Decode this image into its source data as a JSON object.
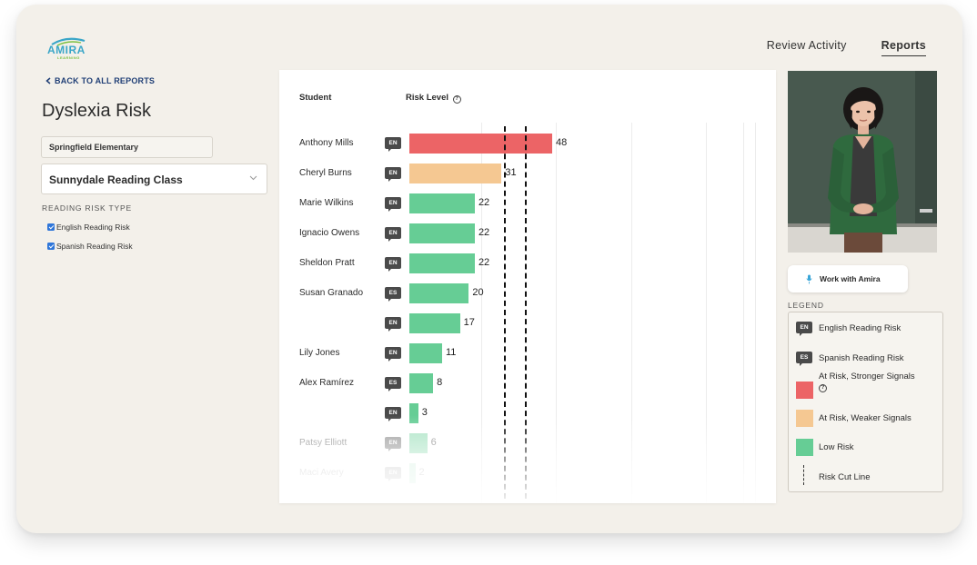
{
  "brand": {
    "logo_word": "AMIRA",
    "logo_sub": "LEARNING"
  },
  "nav": {
    "items": [
      {
        "label": "Review Activity"
      },
      {
        "label": "Reports"
      }
    ],
    "active": "Reports"
  },
  "sidebar": {
    "back_link": "BACK TO ALL REPORTS",
    "title": "Dyslexia Risk",
    "school": "Springfield Elementary",
    "class_select": "Sunnydale Reading Class",
    "risk_type_heading": "READING RISK TYPE",
    "risk_types": [
      {
        "label": "English Reading Risk",
        "checked": true
      },
      {
        "label": "Spanish Reading Risk",
        "checked": true
      }
    ]
  },
  "table": {
    "col_student": "Student",
    "col_risk": "Risk Level",
    "help_glyph": "?"
  },
  "colors": {
    "at_risk_stronger": "#ec6466",
    "at_risk_weaker": "#f5c892",
    "low_risk": "#66cd95",
    "badge": "#4a4a4a",
    "nav_link": "#1f3e75"
  },
  "chart_data": {
    "type": "bar",
    "orientation": "horizontal",
    "x_range": [
      0,
      80
    ],
    "cut_lines": [
      32,
      39
    ],
    "rows": [
      {
        "student": "Anthony Mills",
        "lang": "EN",
        "value": 48,
        "risk": "at_risk_stronger"
      },
      {
        "student": "Cheryl Burns",
        "lang": "EN",
        "value": 31,
        "risk": "at_risk_weaker"
      },
      {
        "student": "Marie Wilkins",
        "lang": "EN",
        "value": 22,
        "risk": "low_risk"
      },
      {
        "student": "Ignacio Owens",
        "lang": "EN",
        "value": 22,
        "risk": "low_risk"
      },
      {
        "student": "Sheldon Pratt",
        "lang": "EN",
        "value": 22,
        "risk": "low_risk"
      },
      {
        "student": "Susan Granado",
        "lang": "ES",
        "value": 20,
        "risk": "low_risk"
      },
      {
        "student": "",
        "lang": "EN",
        "value": 17,
        "risk": "low_risk"
      },
      {
        "student": "Lily Jones",
        "lang": "EN",
        "value": 11,
        "risk": "low_risk"
      },
      {
        "student": "Alex Ramírez",
        "lang": "ES",
        "value": 8,
        "risk": "low_risk"
      },
      {
        "student": "",
        "lang": "EN",
        "value": 3,
        "risk": "low_risk"
      },
      {
        "student": "Patsy Elliott",
        "lang": "EN",
        "value": 6,
        "risk": "low_risk"
      },
      {
        "student": "Maci Avery",
        "lang": "EN",
        "value": 2,
        "risk": "low_risk"
      }
    ]
  },
  "assistant": {
    "button_label": "Work with Amira"
  },
  "legend": {
    "title": "LEGEND",
    "items": [
      {
        "kind": "badge",
        "badge": "EN",
        "label": "English Reading Risk"
      },
      {
        "kind": "badge",
        "badge": "ES",
        "label": "Spanish Reading Risk"
      },
      {
        "kind": "swatch",
        "color": "#ec6466",
        "label": "At Risk, Stronger Signals",
        "help": "?"
      },
      {
        "kind": "swatch",
        "color": "#f5c892",
        "label": "At Risk, Weaker Signals"
      },
      {
        "kind": "swatch",
        "color": "#66cd95",
        "label": "Low Risk"
      },
      {
        "kind": "cut",
        "label": "Risk Cut Line"
      }
    ]
  }
}
